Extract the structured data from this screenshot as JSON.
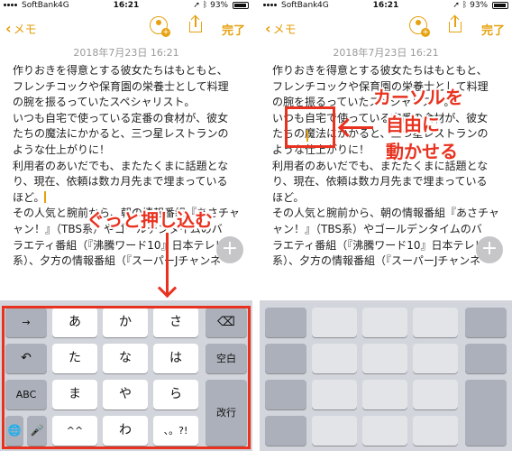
{
  "status_bar": {
    "carrier": "SoftBank",
    "network": "4G",
    "time": "16:21",
    "battery": "93%"
  },
  "nav": {
    "back_label": "メモ",
    "done_label": "完了"
  },
  "note": {
    "date": "2018年7月23日 16:21",
    "lines": [
      "作りおきを得意とする彼女たちはもともと、",
      "フレンチコックや保育園の栄養士として料理",
      "の腕を振るっていたスペシャリスト。",
      "いつも自宅で使っている定番の食材が、彼女",
      "たちの魔法にかかると、三つ星レストランの",
      "ような仕上がりに！",
      "利用者のあいだでも、またたくまに話題とな",
      "り、現在、依頼は数カ月先まで埋まっている",
      "ほど。",
      "その人気と腕前から、朝の情報番組『あさチャ",
      "ャン！』（TBS系）やゴールデンタイムのバ",
      "ラエティ番組（『沸騰ワード10』日本テレビ",
      "系）、夕方の情報番組（『スーパーJチャンネ"
    ]
  },
  "keyboard": {
    "row1": [
      "→",
      "あ",
      "か",
      "さ",
      "⌫"
    ],
    "row2": [
      "↶",
      "た",
      "な",
      "は",
      "空白"
    ],
    "row3": [
      "ABC",
      "ま",
      "や",
      "ら"
    ],
    "row4": [
      "🌐",
      "🎤",
      "^^",
      "わ",
      "、。?!"
    ],
    "return_label": "改行"
  },
  "annotations": {
    "left_label": "ぐっと押し込む",
    "right_label_1": "カーソルを",
    "right_label_2": "自由に",
    "right_label_3": "動かせる",
    "color": "#e8321f"
  },
  "colors": {
    "accent": "#e6a10f",
    "keyboard_bg": "#d2d5db",
    "func_key": "#abb0ba"
  }
}
